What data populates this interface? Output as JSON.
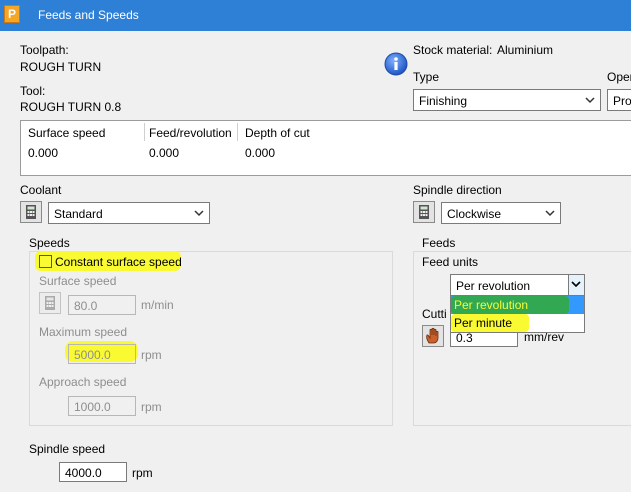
{
  "window": {
    "title": "Feeds and Speeds",
    "app_letter": "P"
  },
  "toolpath": {
    "label": "Toolpath:",
    "value": "ROUGH TURN"
  },
  "tool": {
    "label": "Tool:",
    "value": "ROUGH TURN 0.8"
  },
  "stock": {
    "label": "Stock material:",
    "value": "Aluminium"
  },
  "type": {
    "label": "Type",
    "value": "Finishing"
  },
  "operation": {
    "label": "Oper",
    "value": "Prof"
  },
  "cut_table": {
    "headers": [
      "Surface speed",
      "Feed/revolution",
      "Depth of cut"
    ],
    "row": [
      "0.000",
      "0.000",
      "0.000"
    ]
  },
  "coolant": {
    "label": "Coolant",
    "value": "Standard"
  },
  "spindle_direction": {
    "label": "Spindle direction",
    "value": "Clockwise"
  },
  "speeds": {
    "title": "Speeds",
    "constant_surface_label": "Constant surface speed",
    "surface_speed_label": "Surface speed",
    "surface_speed_value": "80.0",
    "surface_speed_unit": "m/min",
    "max_speed_label": "Maximum speed",
    "max_speed_value": "5000.0",
    "max_speed_unit": "rpm",
    "approach_speed_label": "Approach speed",
    "approach_speed_value": "1000.0",
    "approach_speed_unit": "rpm"
  },
  "spindle_speed": {
    "label": "Spindle speed",
    "value": "4000.0",
    "unit": "rpm"
  },
  "feeds": {
    "title": "Feeds",
    "units_label": "Feed units",
    "units_value": "Per revolution",
    "options": [
      "Per revolution",
      "Per minute"
    ],
    "cutting_label": "Cutti",
    "cutting_value": "0.3",
    "cutting_unit": "mm/rev"
  },
  "colors": {
    "titlebar": "#2e7fd6",
    "highlight": "#fafa33",
    "selected_option": "#3399ff"
  }
}
